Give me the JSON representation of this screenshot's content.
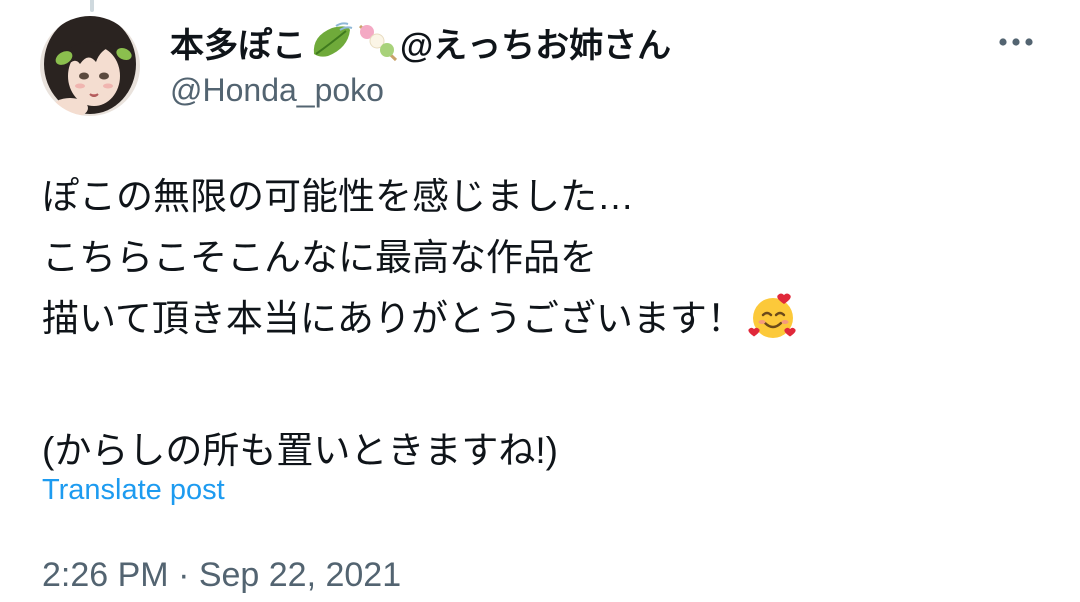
{
  "tweet": {
    "author": {
      "display_name_prefix": "本多ぽこ",
      "display_name_suffix": "@えっちお姉さん",
      "name_emojis": [
        "leaf-fluttering-in-wind-icon",
        "dango-icon"
      ],
      "handle": "@Honda_poko",
      "avatar_icon": "avatar"
    },
    "more_icon": "more-options-icon",
    "body_lines": [
      "ぽこの無限の可能性を感じました…",
      "こちらこそこんなに最高な作品を",
      "描いて頂き本当にありがとうございます！",
      "",
      "(からしの所も置いときますね!)"
    ],
    "inline_emoji": "smiling-face-with-hearts-icon",
    "translate_label": "Translate post",
    "timestamp": "2:26 PM · Sep 22, 2021"
  },
  "colors": {
    "text_primary": "#0f1419",
    "text_secondary": "#536471",
    "link": "#1d9bf0"
  }
}
